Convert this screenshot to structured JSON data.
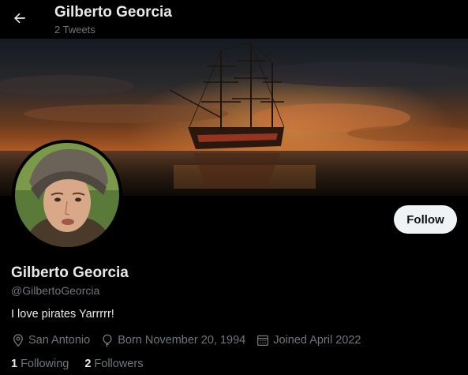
{
  "header": {
    "title": "Gilberto Georcia",
    "subtitle": "2 Tweets",
    "back_icon": "arrow-left-icon"
  },
  "banner": {
    "image": "pirate-ship-sunset"
  },
  "profile": {
    "avatar": "profile-photo",
    "follow_label": "Follow",
    "display_name": "Gilberto Georcia",
    "handle": "@GilbertoGeorcia",
    "bio": "I love pirates Yarrrrr!",
    "location": "San Antonio",
    "born": "Born November 20, 1994",
    "joined": "Joined April 2022",
    "following_count": "1",
    "following_label": "Following",
    "followers_count": "2",
    "followers_label": "Followers"
  },
  "colors": {
    "background": "#000000",
    "text": "#e7e9ea",
    "muted": "#71767b",
    "follow_bg": "#eff3f4"
  }
}
